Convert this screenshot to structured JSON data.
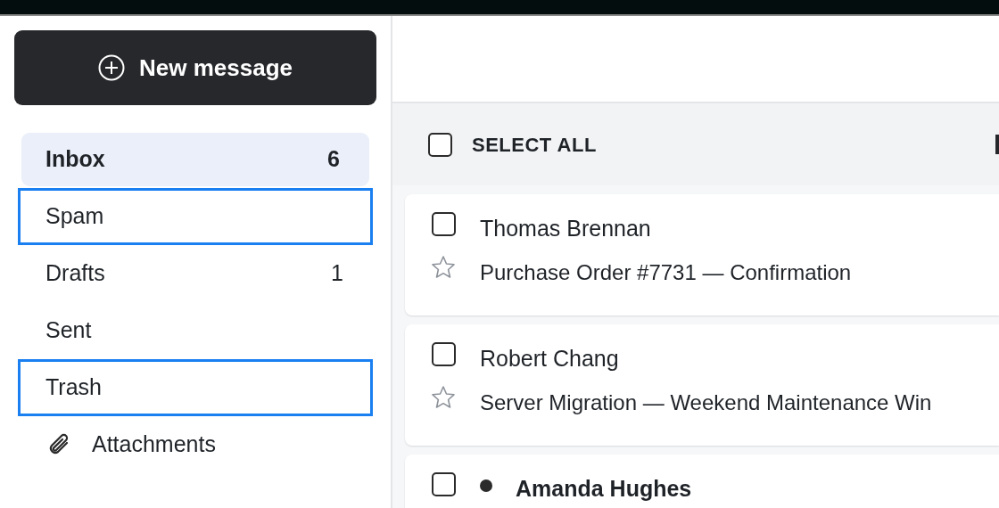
{
  "compose_button": {
    "label": "New message"
  },
  "folders": [
    {
      "kind": "folder",
      "label": "Inbox",
      "count": "6",
      "selected": true,
      "focused": false
    },
    {
      "kind": "folder",
      "label": "Spam",
      "selected": false,
      "focused": true
    },
    {
      "kind": "folder",
      "label": "Drafts",
      "count": "1",
      "selected": false,
      "focused": false
    },
    {
      "kind": "folder",
      "label": "Sent",
      "selected": false,
      "focused": false
    },
    {
      "kind": "folder",
      "label": "Trash",
      "selected": false,
      "focused": true
    },
    {
      "kind": "attachments",
      "label": "Attachments",
      "selected": false,
      "focused": false
    }
  ],
  "list_header": {
    "select_all_label": "SELECT ALL",
    "checked": false
  },
  "messages": [
    {
      "sender": "Thomas Brennan",
      "subject": "Purchase Order #7731 — Confirmation",
      "checked": false,
      "starred": false,
      "unread": false
    },
    {
      "sender": "Robert Chang",
      "subject": "Server Migration — Weekend Maintenance Win",
      "checked": false,
      "starred": false,
      "unread": false
    },
    {
      "sender": "Amanda Hughes",
      "checked": false,
      "unread": true
    }
  ]
}
